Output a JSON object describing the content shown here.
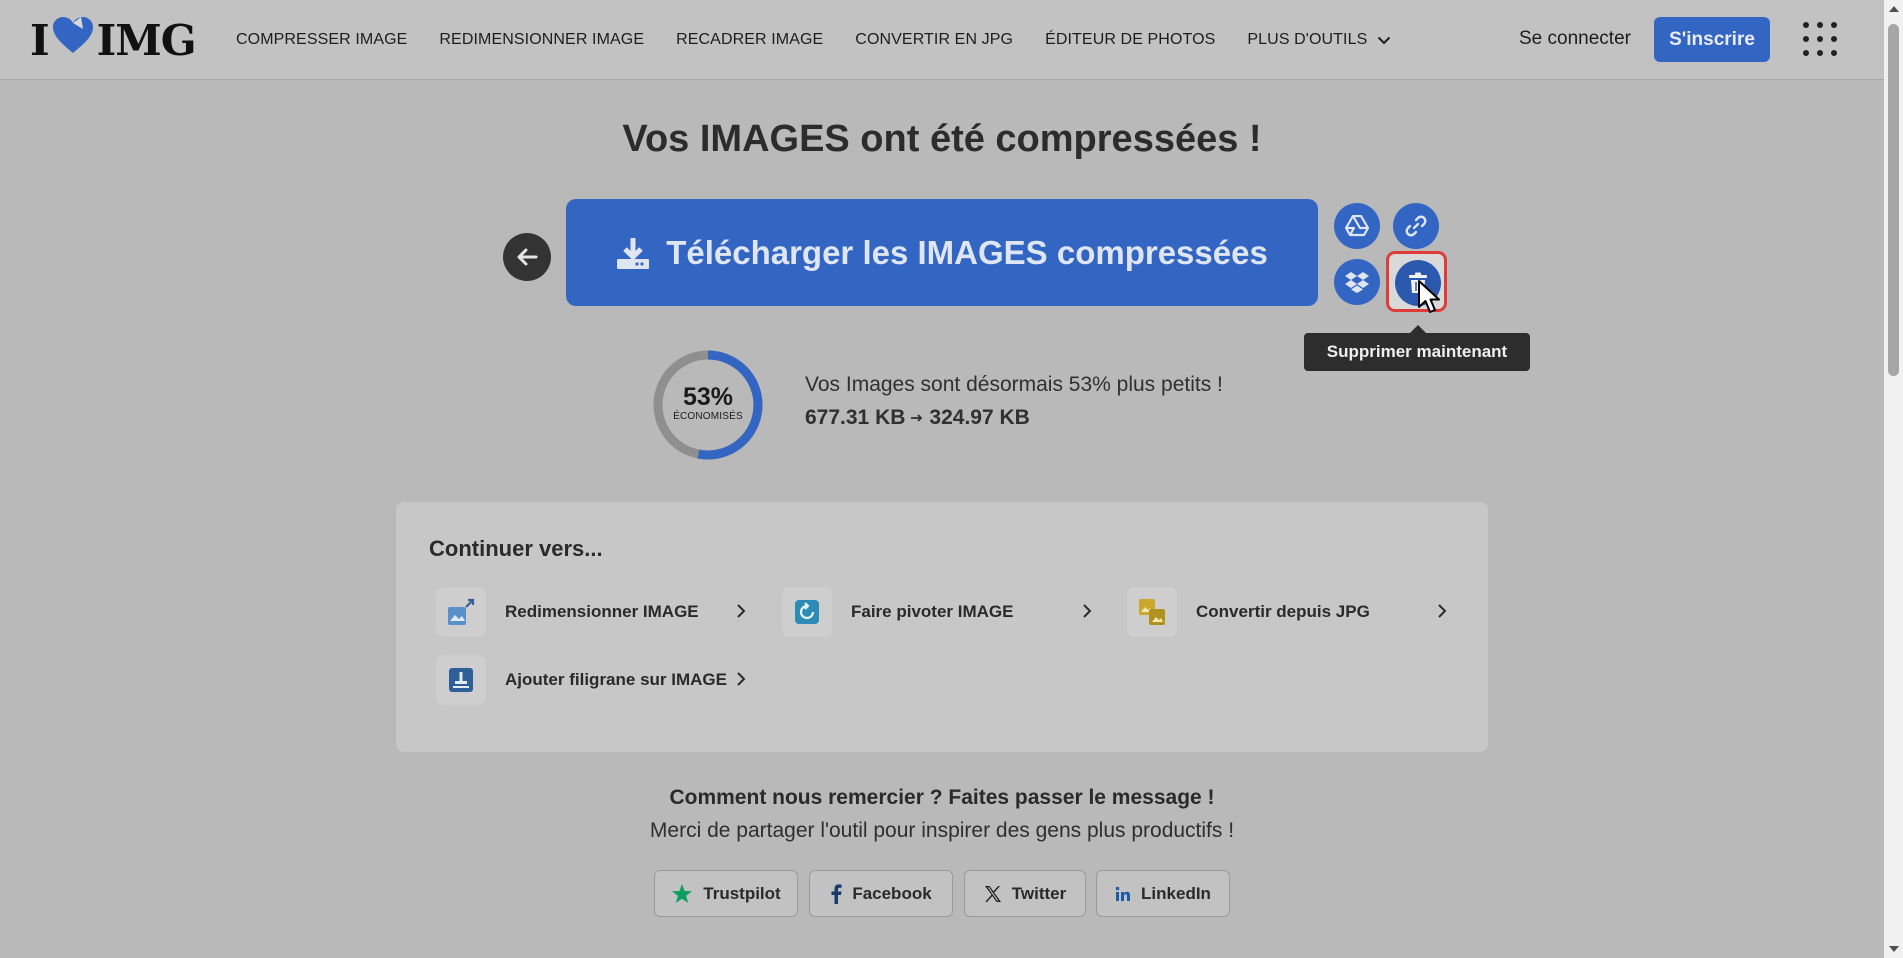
{
  "header": {
    "logo": {
      "left": "I",
      "right": "IMG"
    },
    "nav": [
      {
        "label": "COMPRESSER IMAGE"
      },
      {
        "label": "REDIMENSIONNER IMAGE"
      },
      {
        "label": "RECADRER IMAGE"
      },
      {
        "label": "CONVERTIR EN JPG"
      },
      {
        "label": "ÉDITEUR DE PHOTOS"
      },
      {
        "label": "PLUS D'OUTILS"
      }
    ],
    "login_label": "Se connecter",
    "signup_label": "S'inscrire"
  },
  "main": {
    "title": "Vos IMAGES ont été compressées !",
    "download_label": "Télécharger les IMAGES compressées",
    "tooltip": "Supprimer maintenant",
    "savings": {
      "percent": 53,
      "percent_label": "53%",
      "sub_label": "ÉCONOMISÉS",
      "message": "Vos Images sont désormais 53% plus petits !",
      "size_before": "677.31 KB",
      "size_after": "324.97 KB"
    },
    "continue": {
      "title": "Continuer vers...",
      "tools": [
        {
          "label": "Redimensionner IMAGE",
          "icon": "resize-icon"
        },
        {
          "label": "Faire pivoter IMAGE",
          "icon": "rotate-icon"
        },
        {
          "label": "Convertir depuis JPG",
          "icon": "convert-icon"
        },
        {
          "label": "Ajouter filigrane sur IMAGE",
          "icon": "watermark-icon"
        }
      ]
    },
    "share": {
      "title": "Comment nous remercier ? Faites passer le message !",
      "subtitle": "Merci de partager l'outil pour inspirer des gens plus productifs !",
      "buttons": [
        {
          "label": "Trustpilot"
        },
        {
          "label": "Facebook"
        },
        {
          "label": "Twitter"
        },
        {
          "label": "LinkedIn"
        }
      ]
    }
  },
  "colors": {
    "accent": "#3366c2",
    "danger": "#e03b3b",
    "overlay_bg": "#b9b9b9",
    "trustpilot": "#0a9f5e",
    "linkedin": "#1e5aa8"
  }
}
